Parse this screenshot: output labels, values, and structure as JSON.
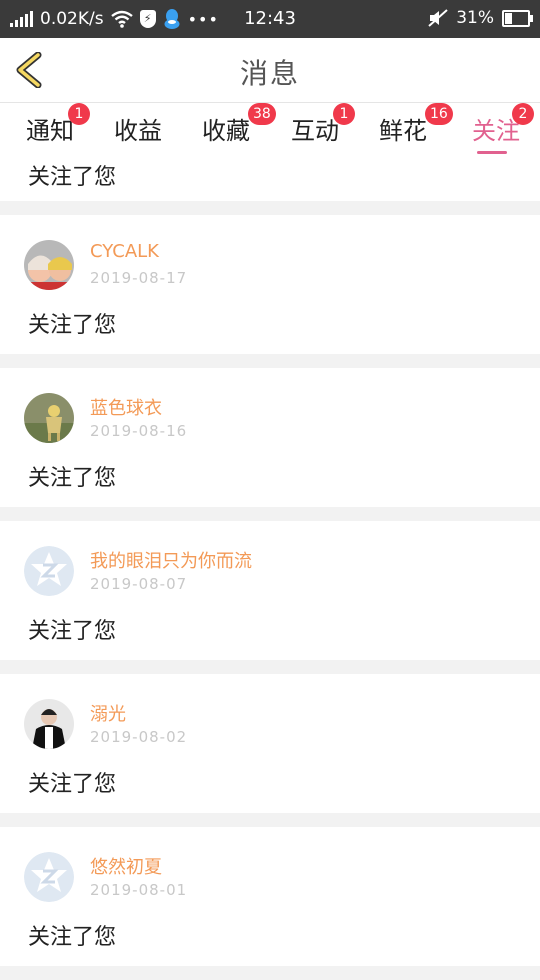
{
  "status_bar": {
    "speed": "0.02K/s",
    "time": "12:43",
    "battery": "31%",
    "battery_level": 0.31
  },
  "header": {
    "title": "消息"
  },
  "tabs": [
    {
      "label": "通知",
      "badge": "1"
    },
    {
      "label": "收益",
      "badge": ""
    },
    {
      "label": "收藏",
      "badge": "38"
    },
    {
      "label": "互动",
      "badge": "1"
    },
    {
      "label": "鲜花",
      "badge": "16"
    },
    {
      "label": "关注",
      "badge": "2"
    }
  ],
  "active_tab": "关注",
  "colors": {
    "accent": "#e1618f",
    "badge": "#f0394b",
    "username": "#f39a57",
    "back_arrow": "#c8a63a"
  },
  "partial_item": {
    "content": "关注了您"
  },
  "items": [
    {
      "name": "CYCALK",
      "date": "2019-08-17",
      "content": "关注了您",
      "avatar": "photo"
    },
    {
      "name": "蓝色球衣",
      "date": "2019-08-16",
      "content": "关注了您",
      "avatar": "photo"
    },
    {
      "name": "我的眼泪只为你而流",
      "date": "2019-08-07",
      "content": "关注了您",
      "avatar": "default-z-icon"
    },
    {
      "name": "溺光",
      "date": "2019-08-02",
      "content": "关注了您",
      "avatar": "photo"
    },
    {
      "name": "悠然初夏",
      "date": "2019-08-01",
      "content": "关注了您",
      "avatar": "default-z-icon"
    }
  ]
}
